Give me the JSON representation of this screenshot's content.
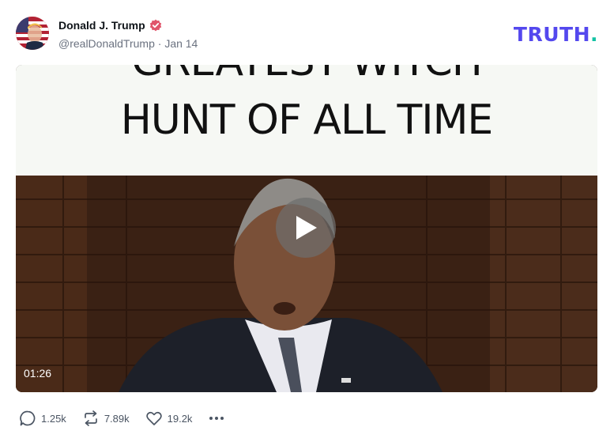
{
  "post": {
    "author_name": "Donald J. Trump",
    "handle": "@realDonaldTrump",
    "separator": "·",
    "date": "Jan 14"
  },
  "brand": {
    "logo_text": "TRUTH",
    "logo_dot": ".",
    "primary_color": "#5448ee",
    "accent_color": "#12c2a4"
  },
  "media": {
    "caption_line1": "GREATEST WITCH",
    "caption_line2": "HUNT OF ALL TIME",
    "duration": "01:26"
  },
  "actions": {
    "replies": "1.25k",
    "retruths": "7.89k",
    "likes": "19.2k"
  },
  "icons": {
    "avatar": "avatar-flag-portrait",
    "verified": "verified-badge-icon",
    "play": "play-icon",
    "reply": "comment-icon",
    "retruth": "repost-icon",
    "like": "heart-icon",
    "more": "more-horizontal-icon"
  }
}
